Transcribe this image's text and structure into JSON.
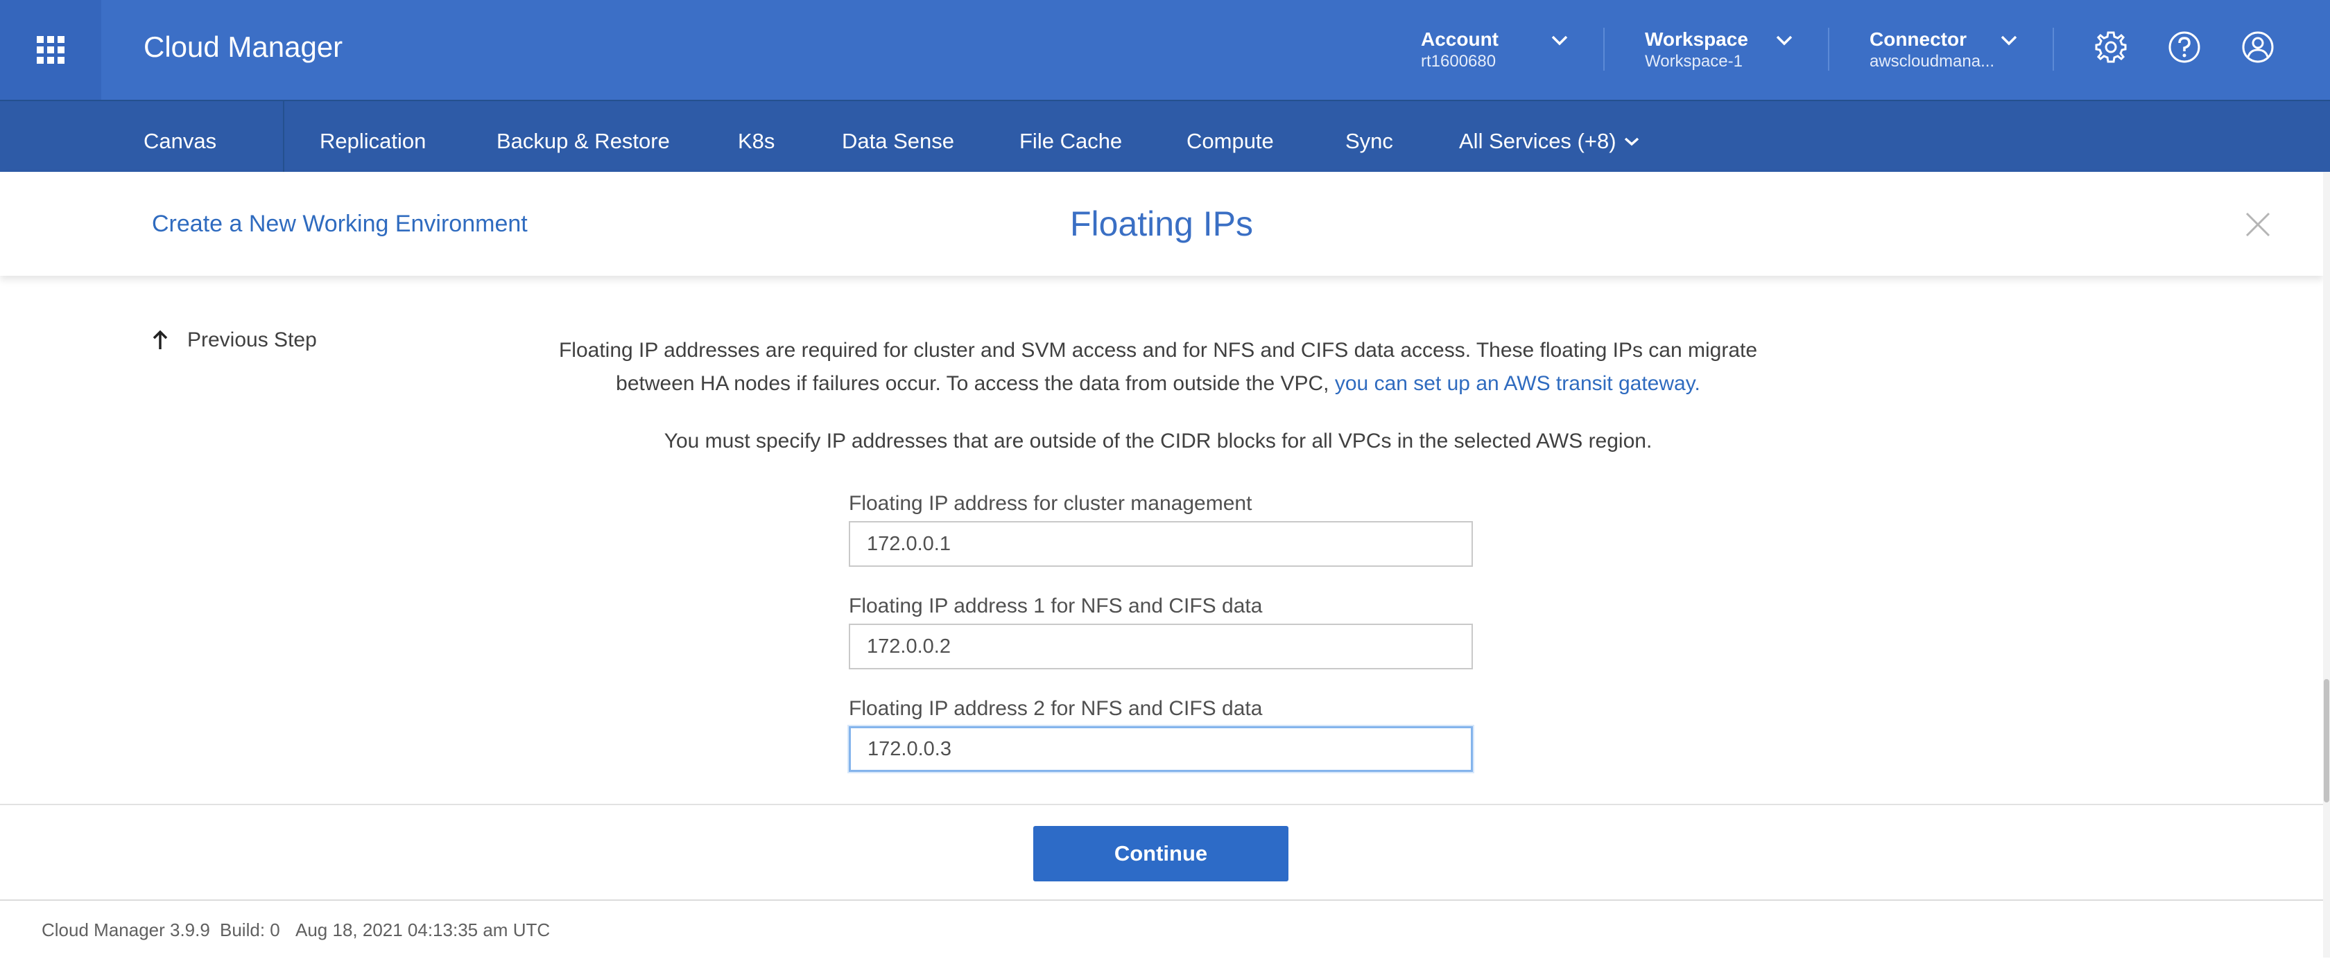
{
  "header": {
    "app_title": "Cloud Manager",
    "account": {
      "label": "Account",
      "value": "rt1600680"
    },
    "workspace": {
      "label": "Workspace",
      "value": "Workspace-1"
    },
    "connector": {
      "label": "Connector",
      "value": "awscloudmana..."
    },
    "icons": [
      "apps-grid-icon",
      "settings-gear-icon",
      "help-icon",
      "user-profile-icon"
    ]
  },
  "nav": {
    "items": [
      "Canvas",
      "Replication",
      "Backup & Restore",
      "K8s",
      "Data Sense",
      "File Cache",
      "Compute",
      "Sync",
      "All Services (+8)"
    ]
  },
  "subheader": {
    "create_link": "Create a New Working Environment",
    "title": "Floating IPs"
  },
  "content": {
    "previous_step": "Previous Step",
    "intro_text": "Floating IP addresses are required for cluster and SVM access and for NFS and CIFS data access. These floating IPs can migrate between HA nodes if failures occur. To access the data from outside the VPC, ",
    "intro_link": "you can set up an AWS transit gateway.",
    "note": "You must specify IP addresses that are outside of the CIDR blocks for all VPCs in the selected AWS region.",
    "fields": [
      {
        "label": "Floating IP address for cluster management",
        "value": "172.0.0.1"
      },
      {
        "label": "Floating IP address 1 for NFS and CIFS data",
        "value": "172.0.0.2"
      },
      {
        "label": "Floating IP address 2 for NFS and CIFS data",
        "value": "172.0.0.3"
      }
    ]
  },
  "footer": {
    "continue_label": "Continue",
    "version": "Cloud Manager 3.9.9",
    "build": "Build: 0",
    "timestamp": "Aug 18, 2021 04:13:35 am UTC"
  },
  "colors": {
    "header_bg": "#3c6fc6",
    "nav_bg": "#2e5ba7",
    "accent": "#2d6bc7",
    "link": "#2f6bbf"
  }
}
